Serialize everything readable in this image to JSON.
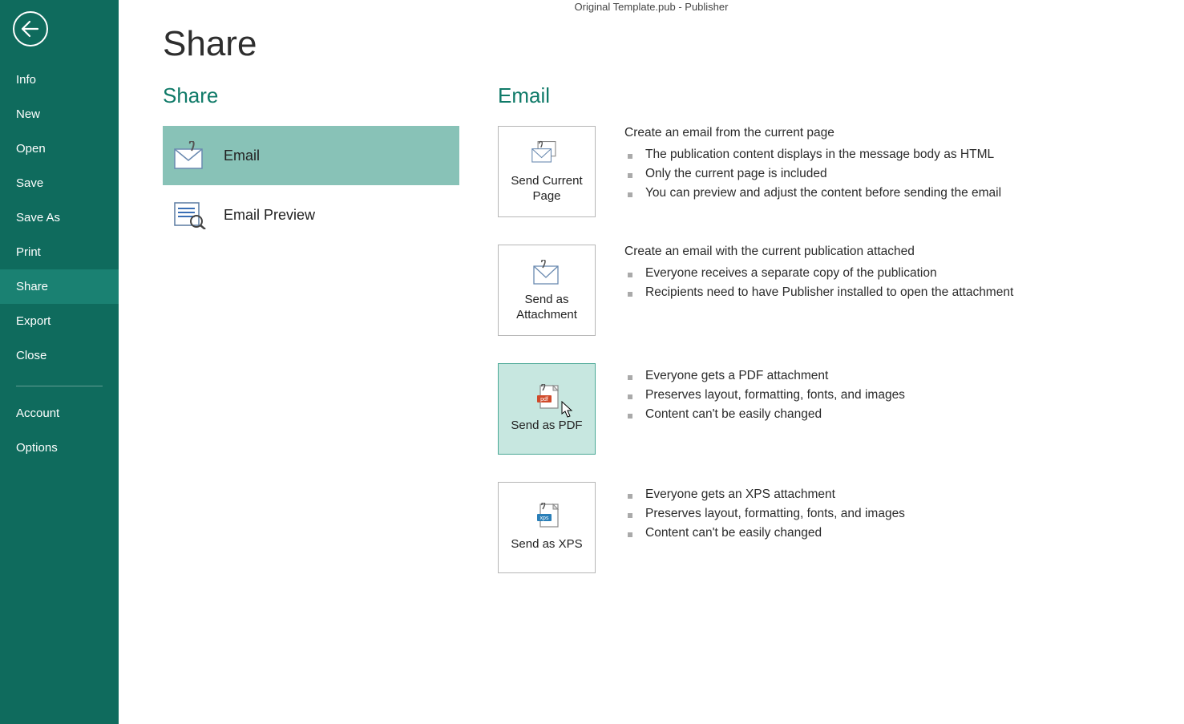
{
  "window": {
    "title": "Original Template.pub - Publisher"
  },
  "sidebar": {
    "items": [
      {
        "label": "Info"
      },
      {
        "label": "New"
      },
      {
        "label": "Open"
      },
      {
        "label": "Save"
      },
      {
        "label": "Save As"
      },
      {
        "label": "Print"
      },
      {
        "label": "Share"
      },
      {
        "label": "Export"
      },
      {
        "label": "Close"
      }
    ],
    "footer": [
      {
        "label": "Account"
      },
      {
        "label": "Options"
      }
    ]
  },
  "page": {
    "title": "Share"
  },
  "shareCol": {
    "heading": "Share",
    "options": [
      {
        "label": "Email",
        "selected": true
      },
      {
        "label": "Email Preview",
        "selected": false
      }
    ]
  },
  "emailCol": {
    "heading": "Email",
    "blocks": [
      {
        "button": "Send Current Page",
        "head": "Create an email from the current page",
        "bullets": [
          "The publication content displays in the message body as HTML",
          "Only the current page is included",
          "You can preview and adjust the content before sending the email"
        ]
      },
      {
        "button": "Send as Attachment",
        "head": "Create an email with the current publication attached",
        "bullets": [
          "Everyone receives a separate copy of the publication",
          "Recipients need to have Publisher installed to open the attachment"
        ]
      },
      {
        "button": "Send as PDF",
        "highlight": true,
        "bullets": [
          "Everyone gets a PDF attachment",
          "Preserves layout, formatting, fonts, and images",
          "Content can't be easily changed"
        ]
      },
      {
        "button": "Send as XPS",
        "bullets": [
          "Everyone gets an XPS attachment",
          "Preserves layout, formatting, fonts, and images",
          "Content can't be easily changed"
        ]
      }
    ]
  }
}
